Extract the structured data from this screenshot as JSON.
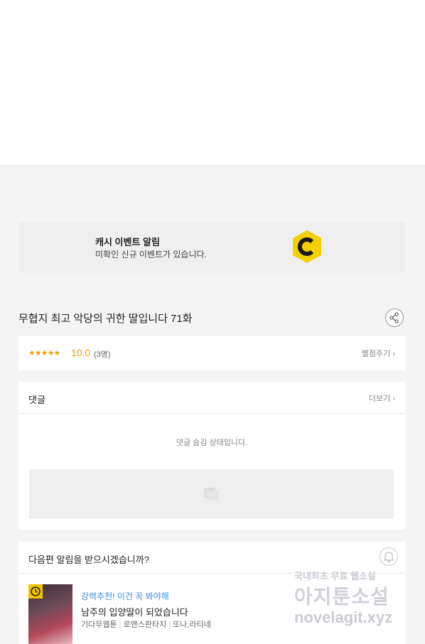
{
  "banner": {
    "title": "캐시 이벤트 알림",
    "description": "미확인 신규 이벤트가 있습니다.",
    "logo_color": "#f5d000"
  },
  "episode": {
    "title": "무협지 최고 악당의 귀한 딸입니다 71화"
  },
  "rating": {
    "stars": "★★★★★",
    "score": "10.0",
    "count": "(3명)",
    "rate_link": "별점주기 ›",
    "star_fraction": 1.0
  },
  "comments": {
    "header": "댓글",
    "more": "더보기 ›",
    "hidden_message": "댓글 숨김 상태입니다."
  },
  "notify": {
    "question": "다음편 알림을 받으시겠습니까?"
  },
  "recommendation": {
    "label": "강력추천! 이건 꼭 봐야해",
    "title": "남주의 입양딸이 되었습니다",
    "tag1": "기다무웹툰",
    "tag2": "로맨스판타지",
    "author": "또나,라티네",
    "separator": "|"
  },
  "watermark": {
    "line1": "국내최초 무료 웹소설",
    "line2": "아지툰소설",
    "line3": "novelagit.xyz"
  },
  "colors": {
    "accent_blue": "#3a8cdf",
    "star_orange": "#f39c12"
  }
}
